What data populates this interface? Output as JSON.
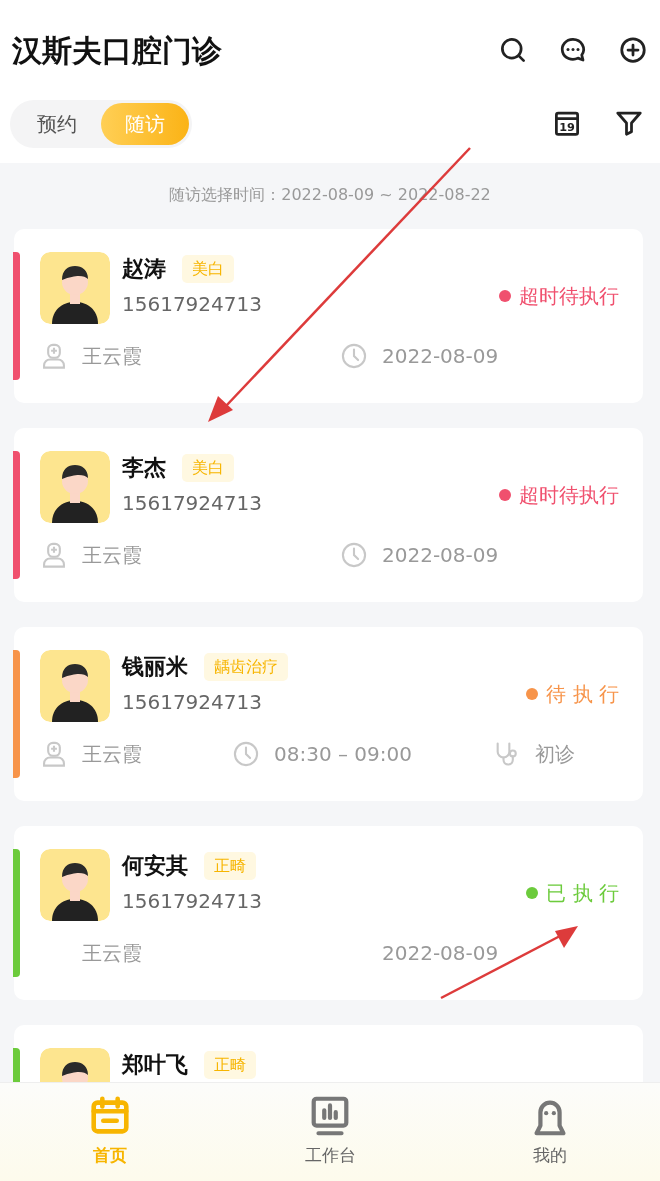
{
  "header": {
    "title": "汉斯夫口腔门诊"
  },
  "segments": [
    {
      "label": "预约",
      "selected": false
    },
    {
      "label": "随访",
      "selected": true
    }
  ],
  "toolbar": {
    "calendar_day": "19"
  },
  "range_text": "随访选择时间：2022-08-09 ~ 2022-08-22",
  "cards": [
    {
      "name": "赵涛",
      "tag": "美白",
      "phone": "15617924713",
      "status": "超时待执行",
      "color": "#f0506e",
      "icons_shown": true,
      "meta": [
        "王云霞",
        "2022-08-09"
      ]
    },
    {
      "name": "李杰",
      "tag": "美白",
      "phone": "15617924713",
      "status": "超时待执行",
      "color": "#f0506e",
      "icons_shown": true,
      "meta": [
        "王云霞",
        "2022-08-09"
      ]
    },
    {
      "name": "钱丽米",
      "tag": "龋齿治疗",
      "phone": "15617924713",
      "status": "待 执 行",
      "color": "#f7944a",
      "icons_shown": true,
      "meta": [
        "王云霞",
        "08:30 – 09:00",
        "初诊"
      ]
    },
    {
      "name": "何安其",
      "tag": "正畸",
      "phone": "15617924713",
      "status": "已 执 行",
      "color": "#6ccb3c",
      "icons_shown": false,
      "meta": [
        "王云霞",
        "2022-08-09"
      ]
    },
    {
      "name": "郑叶飞",
      "tag": "正畸",
      "color": "#6ccb3c"
    }
  ],
  "tabbar": [
    {
      "label": "首页",
      "selected": true
    },
    {
      "label": "工作台",
      "selected": false
    },
    {
      "label": "我的",
      "selected": false
    }
  ]
}
